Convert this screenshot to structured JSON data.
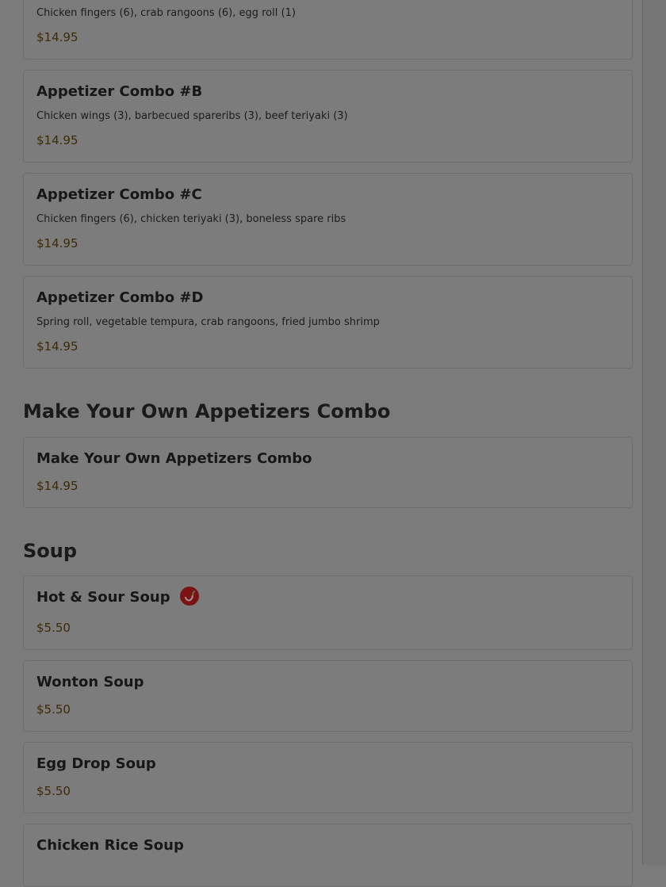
{
  "colors": {
    "overlay_background": "#7b7b7b",
    "card_background": "#7c7c7c",
    "price": "#3e2a06",
    "spicy_icon": "#7a1414"
  },
  "sections": [
    {
      "items": [
        {
          "description": "Chicken fingers (6), crab rangoons (6), egg roll (1)",
          "price": "$14.95"
        },
        {
          "name": "Appetizer Combo #B",
          "description": "Chicken wings (3), barbecued spareribs (3), beef teriyaki (3)",
          "price": "$14.95"
        },
        {
          "name": "Appetizer Combo #C",
          "description": "Chicken fingers (6), chicken teriyaki (3), boneless spare ribs",
          "price": "$14.95"
        },
        {
          "name": "Appetizer Combo #D",
          "description": "Spring roll, vegetable tempura, crab rangoons, fried jumbo shrimp",
          "price": "$14.95"
        }
      ]
    },
    {
      "title": "Make Your Own Appetizers Combo",
      "items": [
        {
          "name": "Make Your Own Appetizers Combo",
          "price": "$14.95"
        }
      ]
    },
    {
      "title": "Soup",
      "items": [
        {
          "name": "Hot & Sour Soup",
          "icon": "spicy-pepper-icon",
          "price": "$5.50"
        },
        {
          "name": "Wonton Soup",
          "price": "$5.50"
        },
        {
          "name": "Egg Drop Soup",
          "price": "$5.50"
        },
        {
          "name": "Chicken Rice Soup"
        }
      ]
    }
  ]
}
